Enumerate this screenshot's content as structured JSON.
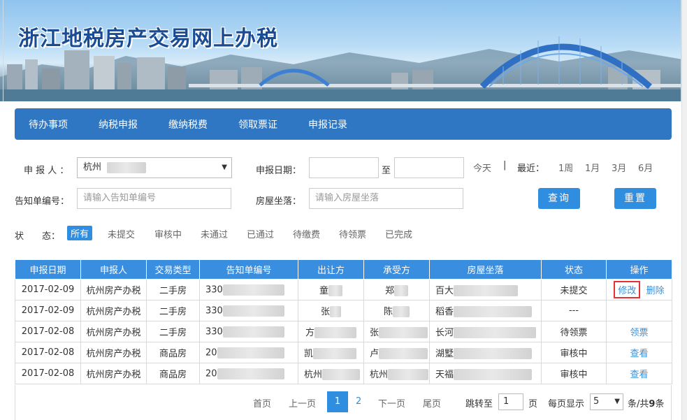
{
  "banner": {
    "title": "浙江地税房产交易网上办税"
  },
  "nav": {
    "items": [
      "待办事项",
      "纳税申报",
      "缴纳税费",
      "领取票证",
      "申报记录"
    ]
  },
  "filters": {
    "reporter_label": "申 报 人 ：",
    "reporter_value": "杭州",
    "date_label": "申报日期：",
    "date_to": "至",
    "notice_label": "告知单编号：",
    "notice_placeholder": "请输入告知单编号",
    "address_label": "房屋坐落：",
    "address_placeholder": "请输入房屋坐落",
    "today": "今天",
    "divider": "|",
    "recent_label": "最近：",
    "recent_options": [
      "1周",
      "1月",
      "3月",
      "6月"
    ],
    "search_button": "查询",
    "reset_button": "重置"
  },
  "status": {
    "label_1": "状",
    "label_2": "态：",
    "items": [
      "所有",
      "未提交",
      "审核中",
      "未通过",
      "已通过",
      "待缴费",
      "待领票",
      "已完成"
    ],
    "active": "所有"
  },
  "table": {
    "headers": [
      "申报日期",
      "申报人",
      "交易类型",
      "告知单编号",
      "出让方",
      "承受方",
      "房屋坐落",
      "状态",
      "操作"
    ],
    "rows": [
      {
        "date": "2017-02-09",
        "reporter": "杭州房产办税",
        "type": "二手房",
        "notice": "330",
        "seller": "童",
        "buyer": "郑",
        "address": "百大",
        "status": "未提交",
        "actions": [
          "修改",
          "删除"
        ]
      },
      {
        "date": "2017-02-09",
        "reporter": "杭州房产办税",
        "type": "二手房",
        "notice": "330",
        "seller": "张",
        "buyer": "陈",
        "address": "稻香",
        "status": "---",
        "actions": []
      },
      {
        "date": "2017-02-08",
        "reporter": "杭州房产办税",
        "type": "二手房",
        "notice": "330",
        "seller": "方",
        "buyer": "张",
        "address": "长河",
        "status": "待领票",
        "actions": [
          "领票"
        ]
      },
      {
        "date": "2017-02-08",
        "reporter": "杭州房产办税",
        "type": "商品房",
        "notice": "20",
        "seller": "凯",
        "buyer": "卢",
        "address": "湖墅",
        "status": "审核中",
        "actions": [
          "查看"
        ]
      },
      {
        "date": "2017-02-08",
        "reporter": "杭州房产办税",
        "type": "商品房",
        "notice": "20",
        "seller": "杭州",
        "buyer": "杭州",
        "address": "天福",
        "status": "审核中",
        "actions": [
          "查看"
        ]
      }
    ]
  },
  "pager": {
    "first": "首页",
    "prev": "上一页",
    "pages": [
      "1",
      "2"
    ],
    "current": "1",
    "next": "下一页",
    "last": "尾页",
    "jump_label": "跳转至",
    "jump_value": "1",
    "page_unit": "页",
    "per_page_label": "每页显示",
    "per_page_value": "5",
    "total_prefix": "条/共",
    "total_count": "9",
    "total_suffix": "条"
  }
}
